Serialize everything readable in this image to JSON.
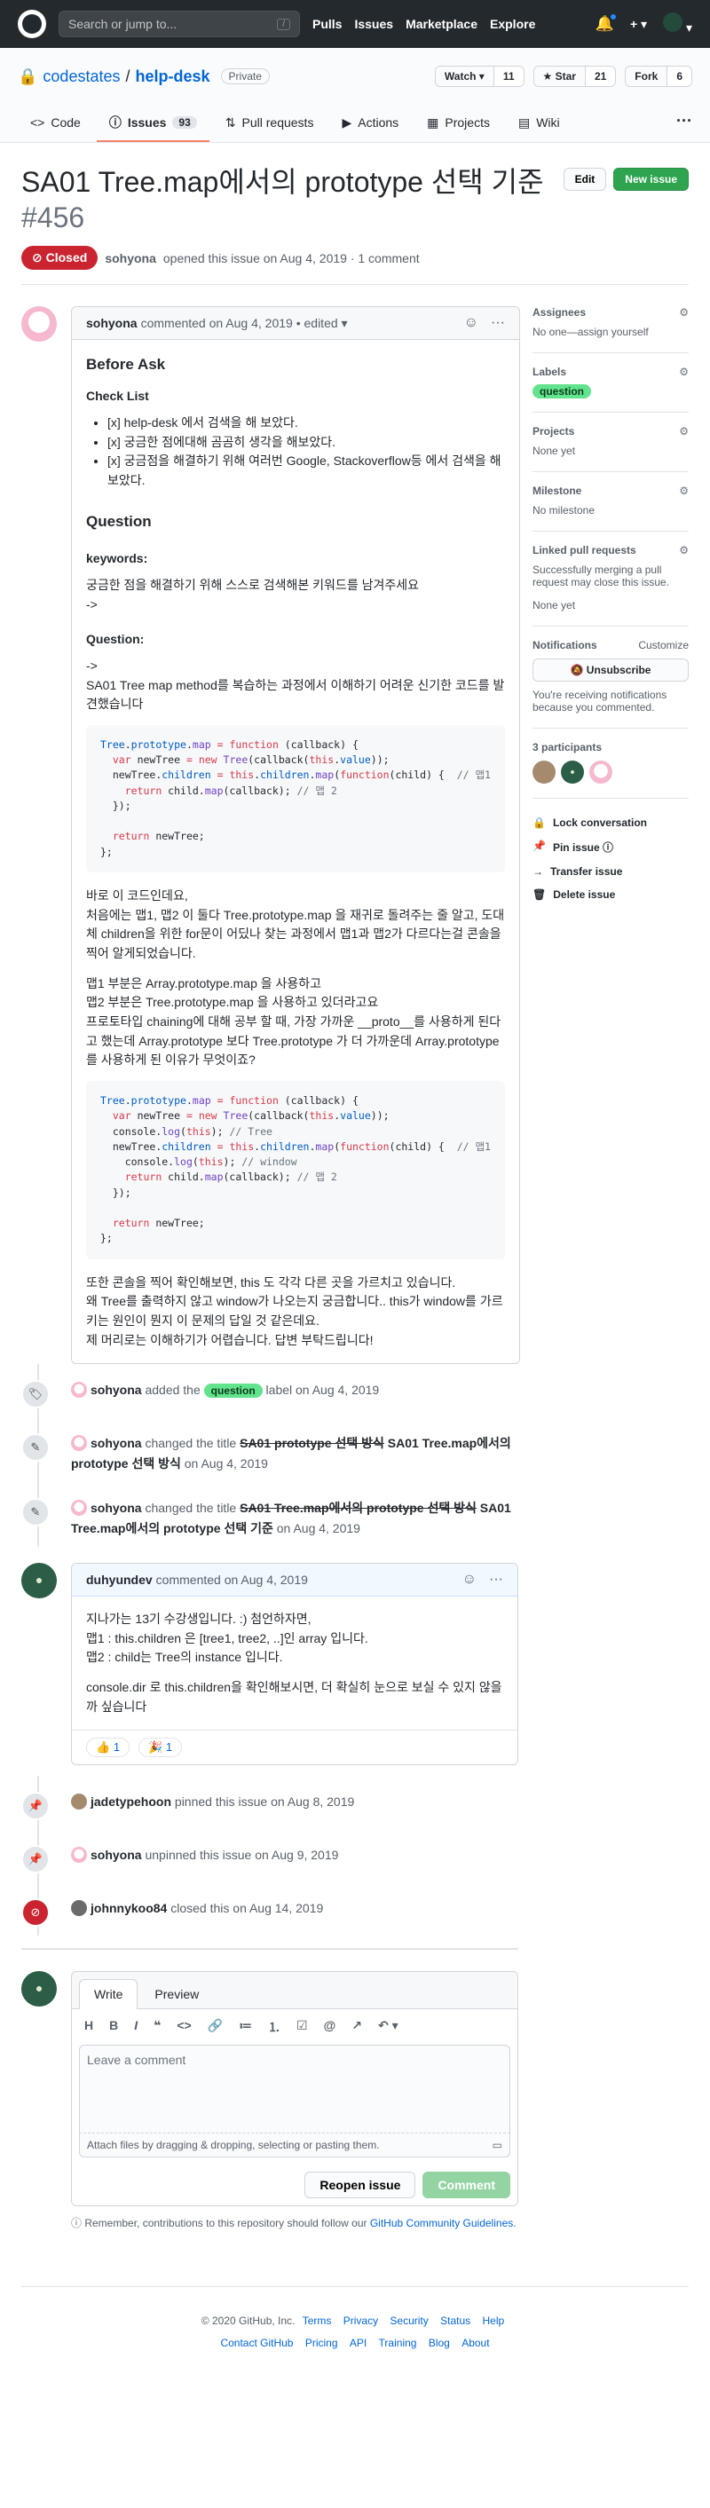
{
  "header": {
    "search_placeholder": "Search or jump to...",
    "search_kbd": "/",
    "nav": [
      "Pulls",
      "Issues",
      "Marketplace",
      "Explore"
    ],
    "plus": "+ ▾"
  },
  "repo": {
    "owner": "codestates",
    "name": "help-desk",
    "visibility": "Private",
    "watch_label": "Watch ▾",
    "watch_count": "11",
    "star_label": "★ Star",
    "star_count": "21",
    "fork_label": "Fork",
    "fork_count": "6",
    "tabs": [
      {
        "label": "Code",
        "icon": "<>"
      },
      {
        "label": "Issues",
        "icon": "ⓘ",
        "count": "93"
      },
      {
        "label": "Pull requests",
        "icon": "⇅"
      },
      {
        "label": "Actions",
        "icon": "▶"
      },
      {
        "label": "Projects",
        "icon": "▦"
      },
      {
        "label": "Wiki",
        "icon": "▤"
      }
    ]
  },
  "issue": {
    "title": "SA01 Tree.map에서의 prototype 선택 기준",
    "number": "#456",
    "state": "Closed",
    "author": "sohyona",
    "opened_text": "opened this issue on Aug 4, 2019 · 1 comment",
    "edit_label": "Edit",
    "new_issue_label": "New issue"
  },
  "comment1": {
    "author": "sohyona",
    "meta": "commented on Aug 4, 2019 • edited ▾",
    "h_before": "Before Ask",
    "h_checklist": "Check List",
    "checklist": [
      "[x] help-desk 에서 검색을 해 보았다.",
      "[x] 궁금한 점에대해 곰곰히 생각을 해보았다.",
      "[x] 궁금점을 해결하기 위해 여러번 Google, Stackoverflow등 에서 검색을 해보았다."
    ],
    "h_question": "Question",
    "h_keywords": "keywords:",
    "keywords_text": "궁금한 점을 해결하기 위해 스스로 검색해본 키워드를 남겨주세요",
    "arrow1": "->",
    "h_question2": "Question:",
    "arrow2": "->",
    "q_text": "SA01 Tree map method를 복습하는 과정에서 이해하기 어려운 신기한 코드를 발견했습니다",
    "p1": "바로 이 코드인데요,",
    "p2": "처음에는 맵1, 맵2 이 둘다 Tree.prototype.map 을 재귀로 돌려주는 줄 알고, 도대체 children을 위한 for문이 어딨나 찾는 과정에서 맵1과 맵2가 다르다는걸 콘솔을 찍어 알게되었습니다.",
    "p3": "맵1 부분은 Array.prototype.map 을 사용하고",
    "p4": "맵2 부분은 Tree.prototype.map 을 사용하고 있더라고요",
    "p5": "프로토타입 chaining에 대해 공부 할 때, 가장 가까운 __proto__를 사용하게 된다고 했는데 Array.prototype 보다 Tree.prototype 가 더 가까운데 Array.prototype 를 사용하게 된 이유가 무엇이죠?",
    "p6": "또한 콘솔을 찍어 확인해보면, this 도 각각 다른 곳을 가르치고 있습니다.",
    "p7": "왜 Tree를 출력하지 않고 window가 나오는지 궁금합니다.. this가 window를 가르키는 원인이 뭔지 이 문제의 답일 것 같은데요.",
    "p8": "제 머리로는 이해하기가 어렵습니다. 답변 부탁드립니다!"
  },
  "events": [
    {
      "type": "label",
      "icon": "🏷",
      "actor": "sohyona",
      "pre": "added the",
      "label": "question",
      "post": "label on Aug 4, 2019"
    },
    {
      "type": "rename",
      "icon": "✎",
      "actor": "sohyona",
      "pre": "changed the title",
      "old": "SA01 prototype 선택 방식",
      "new": "SA01 Tree.map에서의 prototype 선택 방식",
      "post": "on Aug 4, 2019"
    },
    {
      "type": "rename",
      "icon": "✎",
      "actor": "sohyona",
      "pre": "changed the title",
      "old": "SA01 Tree.map에서의 prototype 선택 방식",
      "new": "SA01 Tree.map에서의 prototype 선택 기준",
      "post": "on Aug 4, 2019"
    }
  ],
  "comment2": {
    "author": "duhyundev",
    "meta": "commented on Aug 4, 2019",
    "l1": "지나가는 13기 수강생입니다. :) 첨언하자면,",
    "l2": "맵1 : this.children 은 [tree1, tree2, ..]인 array 입니다.",
    "l3": "맵2 : child는 Tree의 instance 입니다.",
    "l4": "console.dir 로 this.children을 확인해보시면, 더 확실히 눈으로 보실 수 있지 않을까 싶습니다",
    "reactions": [
      {
        "emoji": "👍",
        "count": "1"
      },
      {
        "emoji": "🎉",
        "count": "1"
      }
    ]
  },
  "events2": [
    {
      "icon": "📌",
      "actor": "jadetypehoon",
      "text": "pinned this issue on Aug 8, 2019"
    },
    {
      "icon": "📌",
      "actor": "sohyona",
      "text": "unpinned this issue on Aug 9, 2019"
    },
    {
      "icon": "⊘",
      "actor": "johnnykoo84",
      "text": "closed this on Aug 14, 2019"
    }
  ],
  "editor": {
    "tab_write": "Write",
    "tab_preview": "Preview",
    "toolbar": [
      "H",
      "B",
      "I",
      "❝",
      "<>",
      "🔗",
      "≔",
      "⒈",
      "☑",
      "@",
      "↗",
      "↶ ▾"
    ],
    "placeholder": "Leave a comment",
    "attach": "Attach files by dragging & dropping, selecting or pasting them.",
    "reopen": "Reopen issue",
    "comment": "Comment",
    "tip_pre": "Remember, contributions to this repository should follow our",
    "tip_link": "GitHub Community Guidelines",
    "tip_post": "."
  },
  "sidebar": {
    "assignees_h": "Assignees",
    "assignees_v": "No one—assign yourself",
    "labels_h": "Labels",
    "label_v": "question",
    "projects_h": "Projects",
    "projects_v": "None yet",
    "milestone_h": "Milestone",
    "milestone_v": "No milestone",
    "linked_h": "Linked pull requests",
    "linked_desc": "Successfully merging a pull request may close this issue.",
    "linked_v": "None yet",
    "notif_h": "Notifications",
    "notif_customize": "Customize",
    "unsubscribe": "🔕 Unsubscribe",
    "notif_desc": "You're receiving notifications because you commented.",
    "participants_h": "3 participants",
    "lock": "Lock conversation",
    "pin": "Pin issue ⓘ",
    "transfer": "Transfer issue",
    "delete": "Delete issue"
  },
  "footer": {
    "copy": "© 2020 GitHub, Inc.",
    "row1": [
      "Terms",
      "Privacy",
      "Security",
      "Status",
      "Help"
    ],
    "row2": [
      "Contact GitHub",
      "Pricing",
      "API",
      "Training",
      "Blog",
      "About"
    ]
  },
  "colors": {
    "accent": "#0366d6",
    "closed": "#cb2431",
    "green": "#2ea44f",
    "label_question": "#62e38d"
  }
}
